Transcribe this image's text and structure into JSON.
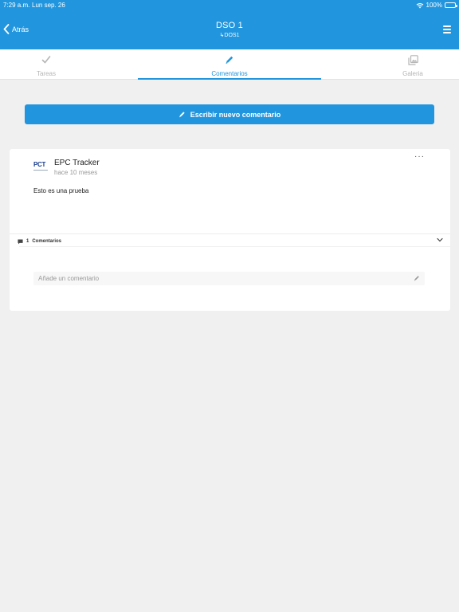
{
  "status_bar": {
    "time": "7:29 a.m.",
    "date": "Lun sep. 26",
    "battery": "100%"
  },
  "header": {
    "back_label": "Atrás",
    "title": "DSO 1",
    "subtitle": "↳DOS1"
  },
  "tabs": [
    {
      "label": "Tareas",
      "icon": "check-icon",
      "active": false
    },
    {
      "label": "Comentarios",
      "icon": "pencil-icon",
      "active": true
    },
    {
      "label": "Galeria",
      "icon": "gallery-icon",
      "active": false
    }
  ],
  "write_button": {
    "label": "Escribir nuevo comentario"
  },
  "post": {
    "logo_text": "PCT",
    "author": "EPC Tracker",
    "time_ago": "hace 10 meses",
    "body": "Esto es una prueba",
    "more": "···",
    "comments_count": "1",
    "comments_label": "Comentarios",
    "add_comment_placeholder": "Añade un comentario"
  },
  "colors": {
    "accent": "#2196de",
    "background": "#f0f0f0",
    "inactive_tab": "#b5b5b5"
  }
}
